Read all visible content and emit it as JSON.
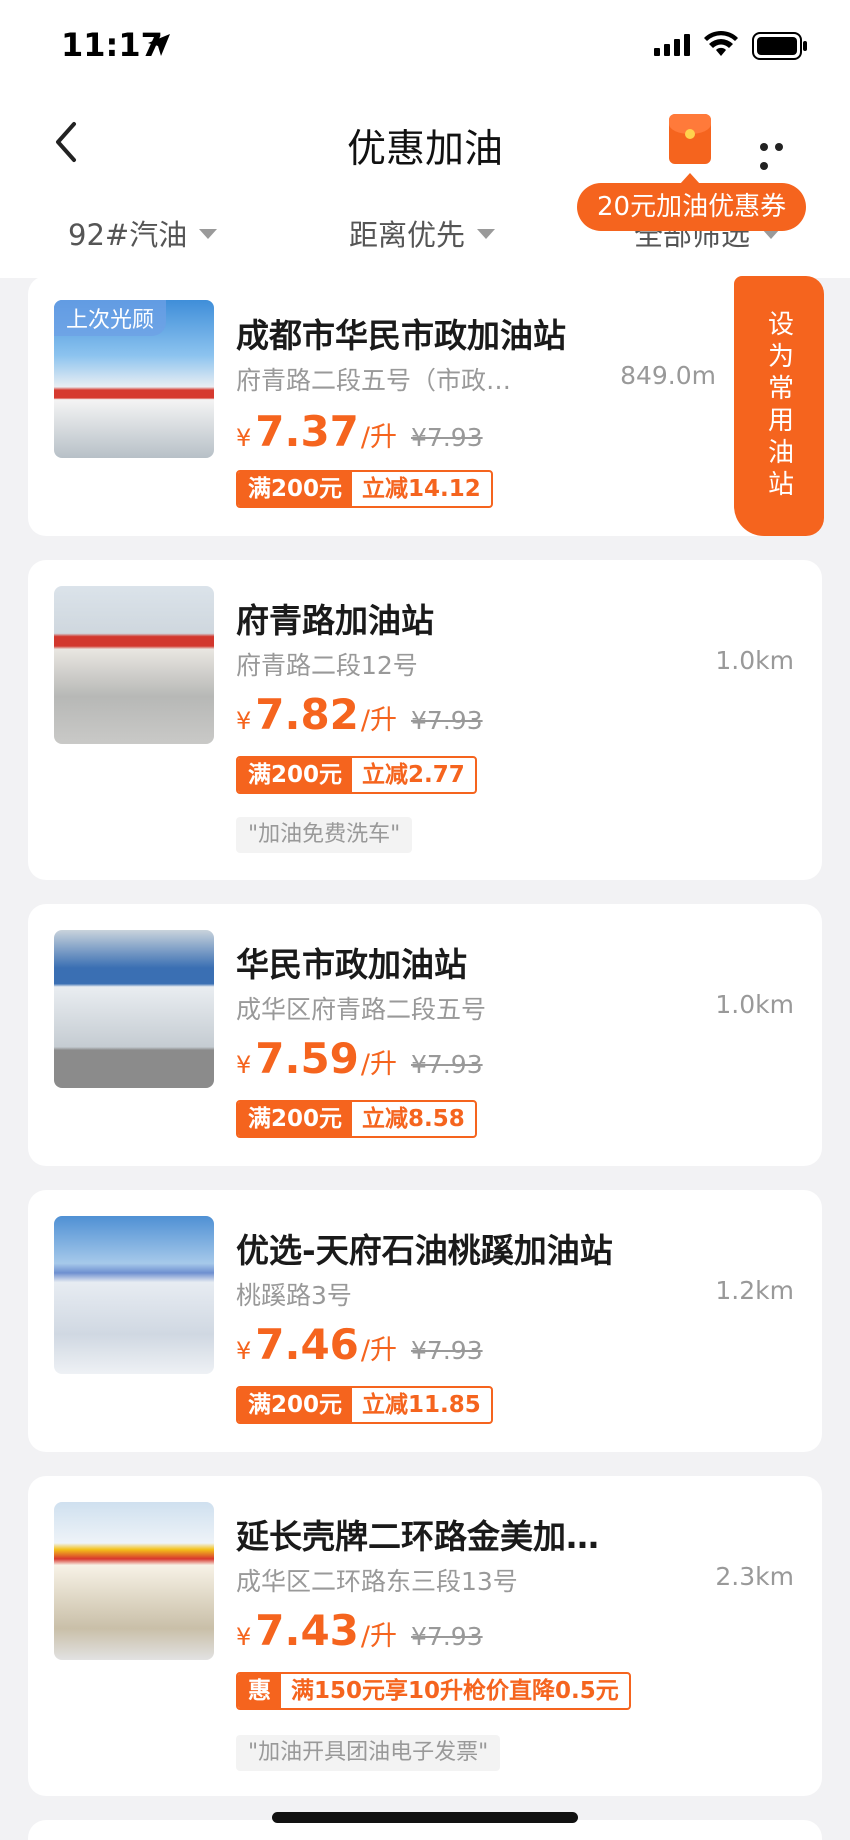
{
  "status_bar": {
    "time": "11:17"
  },
  "nav": {
    "title": "优惠加油"
  },
  "filters": {
    "fuel": "92#汽油",
    "sort": "距离优先",
    "all": "全部筛选"
  },
  "coupon_tip": "20元加油优惠券",
  "fav_button": "设为常用油站",
  "stations": [
    {
      "badge": "上次光顾",
      "name": "成都市华民市政加油站",
      "address": "府青路二段五号（市政…",
      "distance": "849.0m",
      "yen": "¥",
      "price": "7.37",
      "unit": "/升",
      "original_price": "¥7.93",
      "promo_left": "满200元",
      "promo_right": "立减14.12"
    },
    {
      "name": "府青路加油站",
      "address": "府青路二段12号",
      "distance": "1.0km",
      "yen": "¥",
      "price": "7.82",
      "unit": "/升",
      "original_price": "¥7.93",
      "promo_left": "满200元",
      "promo_right": "立减2.77",
      "tag": "\"加油免费洗车\""
    },
    {
      "name": "华民市政加油站",
      "address": "成华区府青路二段五号",
      "distance": "1.0km",
      "yen": "¥",
      "price": "7.59",
      "unit": "/升",
      "original_price": "¥7.93",
      "promo_left": "满200元",
      "promo_right": "立减8.58"
    },
    {
      "name": "优选-天府石油桃蹊加油站",
      "address": "桃蹊路3号",
      "distance": "1.2km",
      "yen": "¥",
      "price": "7.46",
      "unit": "/升",
      "original_price": "¥7.93",
      "promo_left": "满200元",
      "promo_right": "立减11.85"
    },
    {
      "name": "延长壳牌二环路金美加…",
      "address": "成华区二环路东三段13号",
      "distance": "2.3km",
      "yen": "¥",
      "price": "7.43",
      "unit": "/升",
      "original_price": "¥7.93",
      "promo_left": "惠",
      "promo_right": "满150元享10升枪价直降0.5元",
      "tag": "\"加油开具团油电子发票\""
    }
  ],
  "colors": {
    "accent": "#f5641e"
  }
}
